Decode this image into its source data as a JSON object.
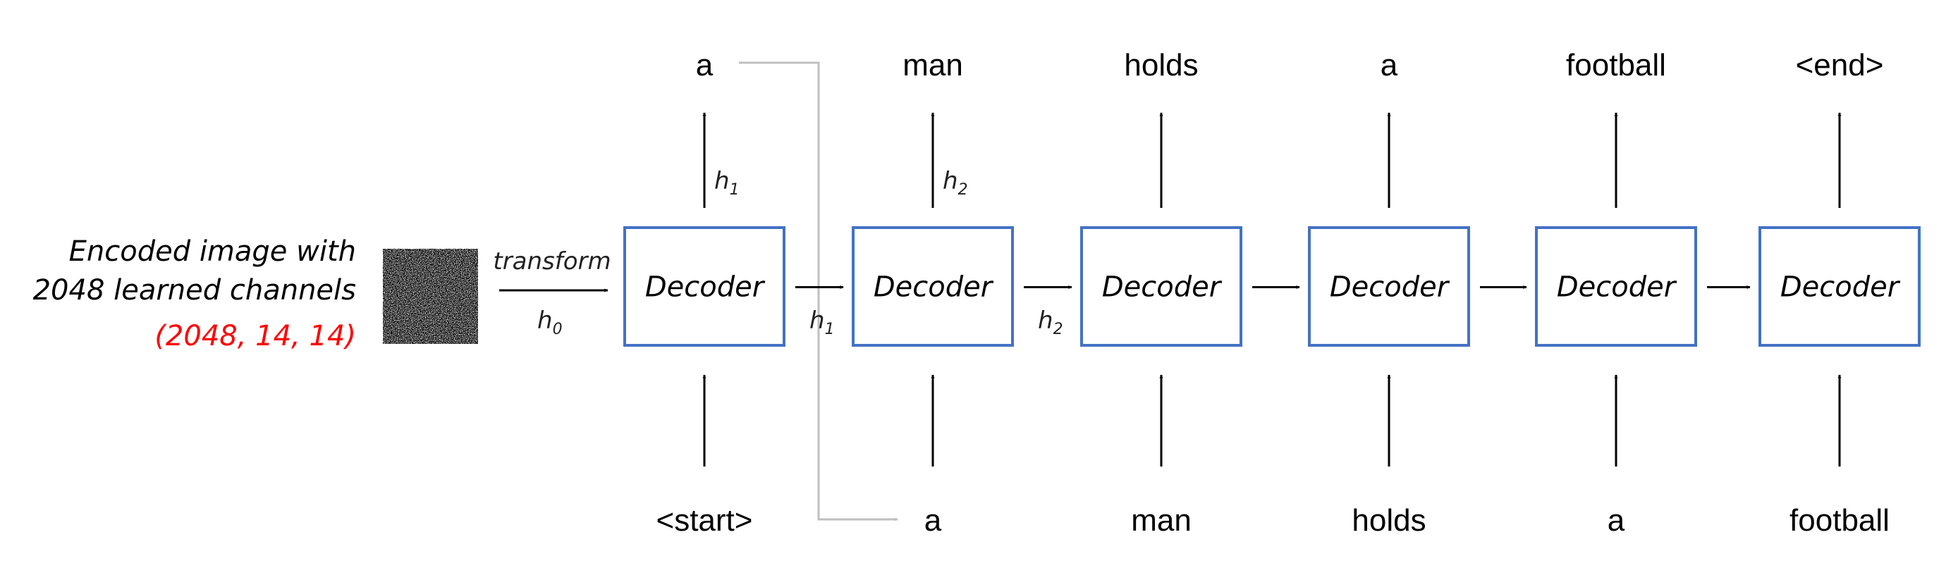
{
  "diagram": {
    "encoder_description": {
      "lines": [
        "Encoded image with",
        "2048 learned channels"
      ],
      "shape": "(2048, 14, 14)"
    },
    "transform_label": "transform",
    "initial_hidden": {
      "base": "h",
      "sub": "0"
    },
    "decoder_label": "Decoder",
    "steps": [
      {
        "input": "<start>",
        "output": "a",
        "hidden_out": {
          "base": "h",
          "sub": "1"
        },
        "show_hidden_up": true,
        "show_hidden_right": true
      },
      {
        "input": "a",
        "output": "man",
        "hidden_out": {
          "base": "h",
          "sub": "2"
        },
        "show_hidden_up": true,
        "show_hidden_right": true
      },
      {
        "input": "man",
        "output": "holds",
        "hidden_out": null,
        "show_hidden_up": false,
        "show_hidden_right": false
      },
      {
        "input": "holds",
        "output": "a",
        "hidden_out": null,
        "show_hidden_up": false,
        "show_hidden_right": false
      },
      {
        "input": "a",
        "output": "football",
        "hidden_out": null,
        "show_hidden_up": false,
        "show_hidden_right": false
      },
      {
        "input": "football",
        "output": "<end>",
        "hidden_out": null,
        "show_hidden_up": false,
        "show_hidden_right": false
      }
    ],
    "feedback_connection": {
      "from_step_output": 0,
      "to_step_input": 1
    },
    "colors": {
      "box_border": "#4472C4",
      "shape_text": "#FF0000",
      "feedback_line": "#BFBFBF",
      "arrow": "#000000"
    }
  }
}
